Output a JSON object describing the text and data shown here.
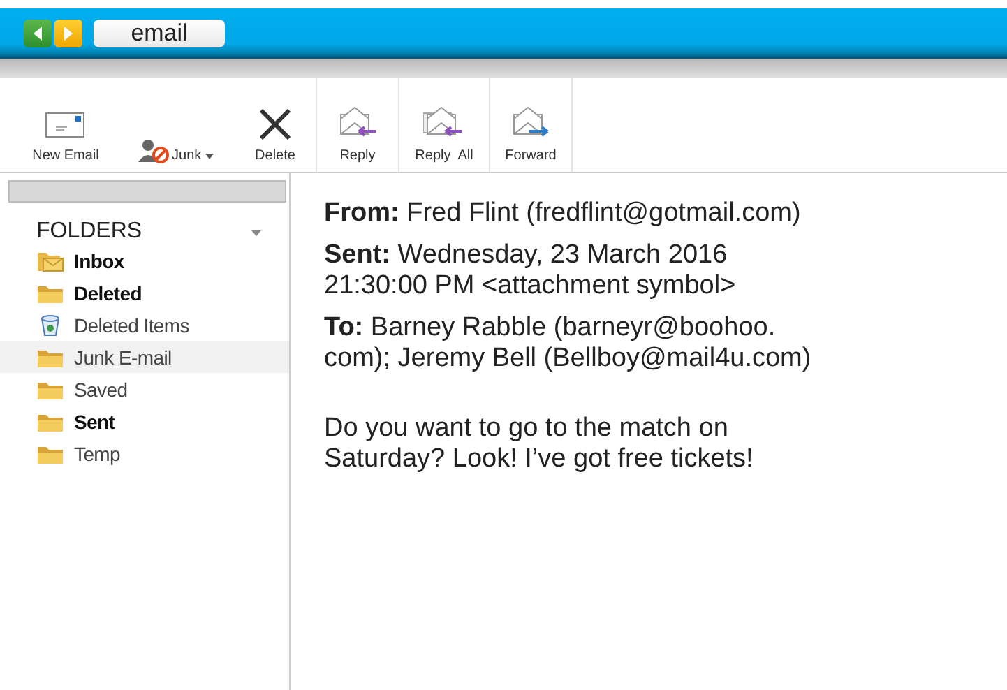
{
  "window": {
    "title": "email"
  },
  "toolbar": [
    {
      "kind": "new",
      "label": "New Email"
    },
    {
      "kind": "junk",
      "label": "Junk"
    },
    {
      "kind": "delete",
      "label": "Delete"
    },
    {
      "kind": "reply",
      "label": "Reply"
    },
    {
      "kind": "replyall",
      "label": "Reply  All"
    },
    {
      "kind": "forward",
      "label": "Forward"
    }
  ],
  "sidebar": {
    "heading": "FOLDERS",
    "items": [
      {
        "kind": "inbox",
        "label": "Inbox",
        "unread": true,
        "selected": false
      },
      {
        "kind": "folder",
        "label": "Deleted",
        "unread": true,
        "selected": false
      },
      {
        "kind": "trash",
        "label": "Deleted Items",
        "unread": false,
        "selected": false
      },
      {
        "kind": "folder",
        "label": "Junk E-mail",
        "unread": false,
        "selected": true
      },
      {
        "kind": "folder",
        "label": "Saved",
        "unread": false,
        "selected": false
      },
      {
        "kind": "folder",
        "label": "Sent",
        "unread": true,
        "selected": false
      },
      {
        "kind": "folder",
        "label": "Temp",
        "unread": false,
        "selected": false
      }
    ]
  },
  "message": {
    "headers": [
      {
        "label": "From:",
        "lines": [
          "Fred Flint (fredflint@gotmail.com)"
        ]
      },
      {
        "label": "Sent:",
        "lines": [
          "Wednesday, 23 March 2016",
          "21:30:00 PM <attachment symbol>"
        ]
      },
      {
        "label": "To:",
        "lines": [
          "Barney Rabble (barneyr@boohoo.",
          "com); Jeremy Bell (Bellboy@mail4u.com)"
        ]
      }
    ],
    "body": [
      "Do you want to go to the match on",
      "Saturday? Look! I’ve got free tickets!"
    ]
  }
}
